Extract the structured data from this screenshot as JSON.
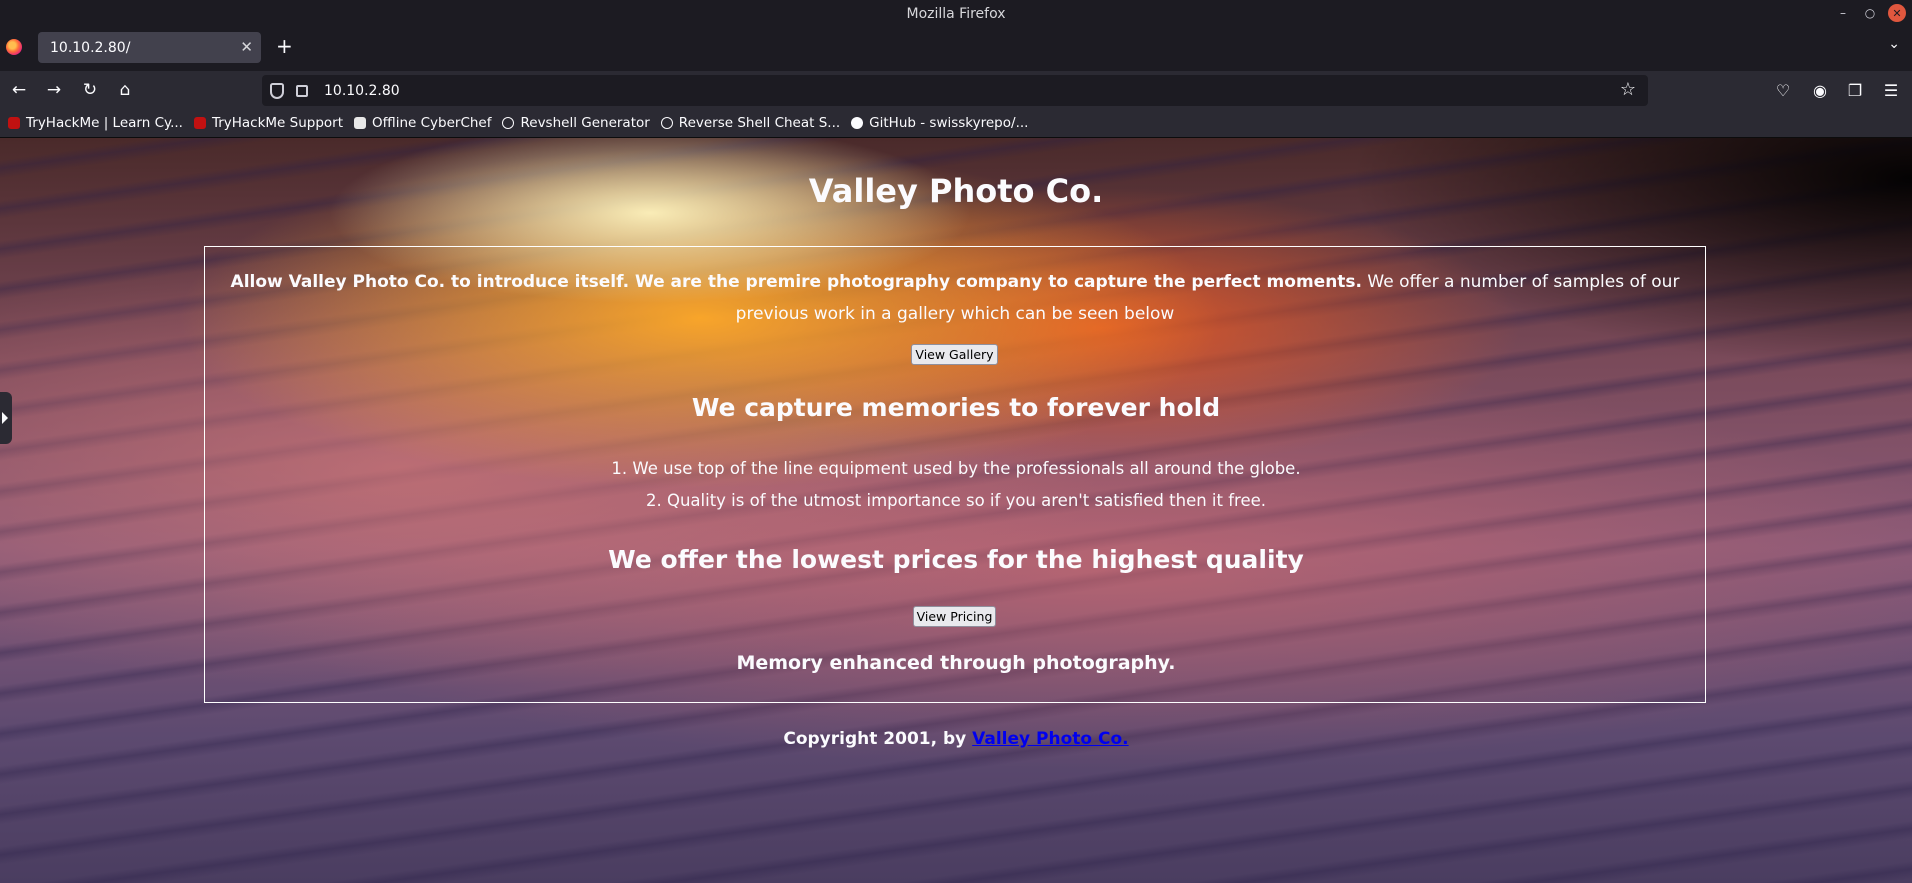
{
  "window": {
    "title": "Mozilla Firefox"
  },
  "tabs": [
    {
      "label": "10.10.2.80/"
    }
  ],
  "toolbar": {
    "url": "10.10.2.80"
  },
  "bookmarks": [
    {
      "label": "TryHackMe | Learn Cy...",
      "icon": "tryhackme-icon"
    },
    {
      "label": "TryHackMe Support",
      "icon": "tryhackme-icon"
    },
    {
      "label": "Offline CyberChef",
      "icon": "chef-icon"
    },
    {
      "label": "Revshell Generator",
      "icon": "globe-icon"
    },
    {
      "label": "Reverse Shell Cheat S...",
      "icon": "globe-icon"
    },
    {
      "label": "GitHub - swisskyrepo/...",
      "icon": "github-icon"
    }
  ],
  "page": {
    "title": "Valley Photo Co.",
    "intro_bold": "Allow Valley Photo Co. to introduce itself. We are the premire photography company to capture the perfect moments.",
    "intro_rest": " We offer a number of samples of our previous work in a gallery which can be seen below",
    "gallery_button": "View Gallery",
    "heading_memories": "We capture memories to forever hold",
    "list": [
      "1. We use top of the line equipment used by the professionals all around the globe.",
      "2. Quality is of the utmost importance so if you aren't satisfied then it free."
    ],
    "heading_prices": "We offer the lowest prices for the highest quality",
    "pricing_button": "View Pricing",
    "tagline": "Memory enhanced through photography.",
    "footer_prefix": "Copyright 2001, by ",
    "footer_link": "Valley Photo Co."
  },
  "colors": {
    "chrome_bg": "#1c1b22",
    "toolbar_bg": "#2b2a33",
    "tab_active": "#42414d",
    "link": "#0000ee"
  }
}
